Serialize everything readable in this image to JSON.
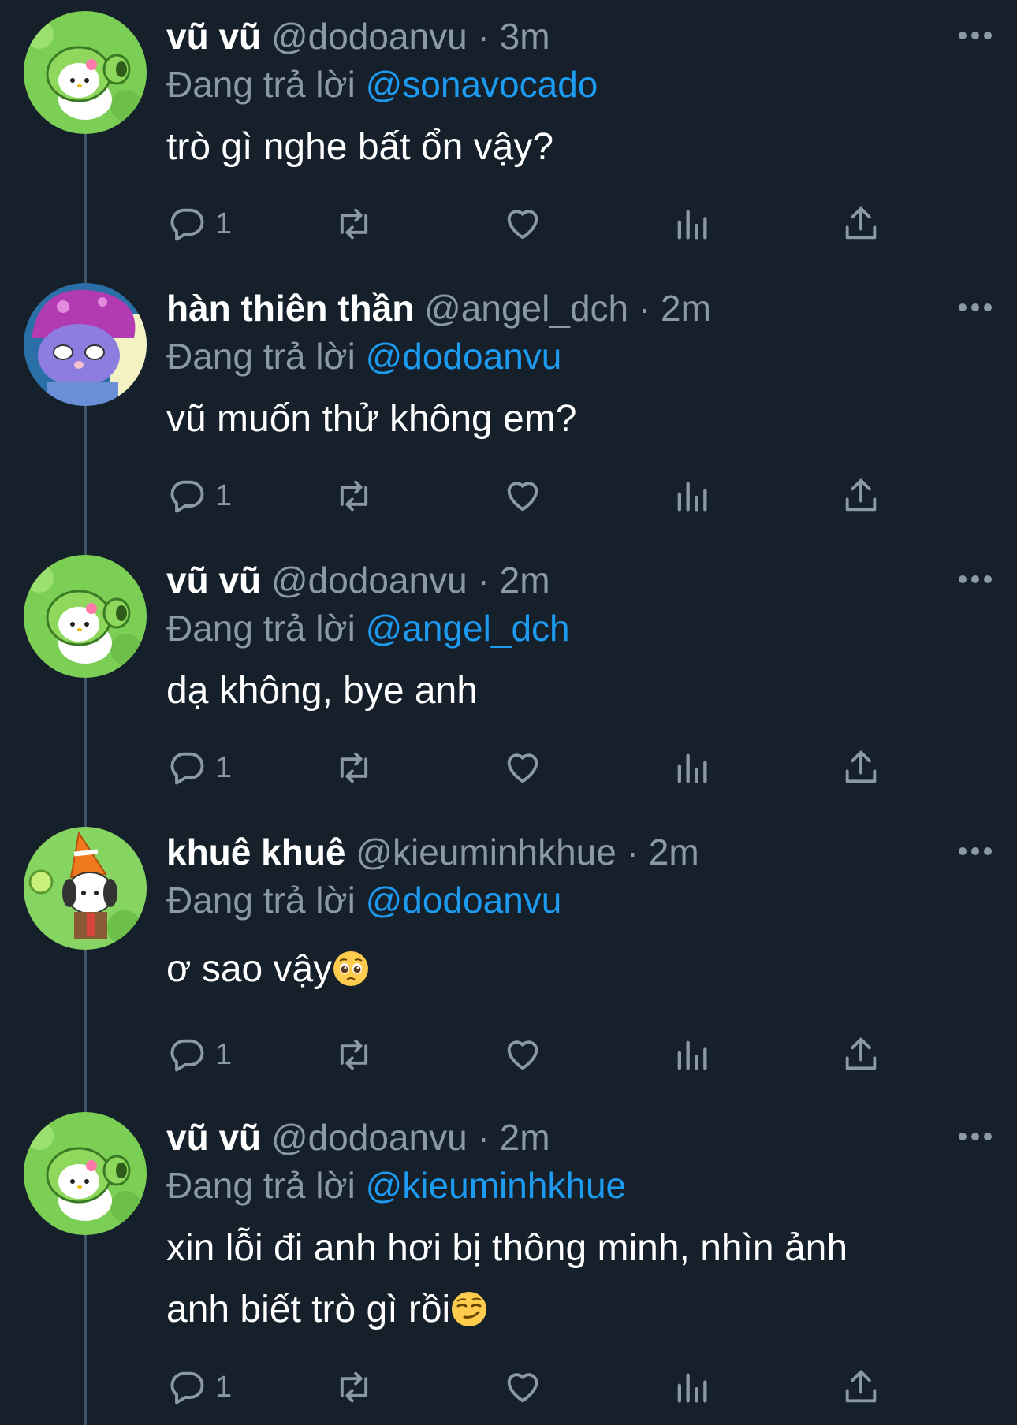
{
  "tweets": [
    {
      "display_name": "vũ vũ",
      "handle": "@dodoanvu",
      "separator": "·",
      "time": "3m",
      "reply_prefix": "Đang trả lời",
      "reply_to": "@sonavocado",
      "text_lines": [
        "trò gì nghe bất ổn vậy?"
      ],
      "reply_count": "1",
      "avatar": "green-peashooter-kitty-avatar"
    },
    {
      "display_name": "hàn thiên thần",
      "handle": "@angel_dch",
      "separator": "·",
      "time": "2m",
      "reply_prefix": "Đang trả lời",
      "reply_to": "@dodoanvu",
      "text_lines": [
        "vũ muốn thử không em?"
      ],
      "reply_count": "1",
      "avatar": "purple-mushroom-melody-avatar"
    },
    {
      "display_name": "vũ vũ",
      "handle": "@dodoanvu",
      "separator": "·",
      "time": "2m",
      "reply_prefix": "Đang trả lời",
      "reply_to": "@angel_dch",
      "text_lines": [
        "dạ không, bye anh"
      ],
      "reply_count": "1",
      "avatar": "green-peashooter-kitty-avatar"
    },
    {
      "display_name": "khuê khuê",
      "handle": "@kieuminhkhue",
      "separator": "·",
      "time": "2m",
      "reply_prefix": "Đang trả lời",
      "reply_to": "@dodoanvu",
      "text_lines": [
        "ơ sao vậy"
      ],
      "emoji": "pleading-face-emoji",
      "reply_count": "1",
      "avatar": "pochacco-conehead-avatar"
    },
    {
      "display_name": "vũ vũ",
      "handle": "@dodoanvu",
      "separator": "·",
      "time": "2m",
      "reply_prefix": "Đang trả lời",
      "reply_to": "@kieuminhkhue",
      "text_lines": [
        "xin lỗi đi anh hơi bị thông minh, nhìn ảnh",
        "anh biết trò gì rồi"
      ],
      "emoji": "smirking-face-emoji",
      "reply_count": "1",
      "avatar": "green-peashooter-kitty-avatar"
    }
  ],
  "colors": {
    "background": "#15202b",
    "muted": "#8b98a5",
    "link": "#1d9bf0",
    "thread_line": "#3d5466"
  },
  "icons": [
    "reply-icon",
    "retweet-icon",
    "like-icon",
    "views-icon",
    "share-icon",
    "more-icon"
  ]
}
